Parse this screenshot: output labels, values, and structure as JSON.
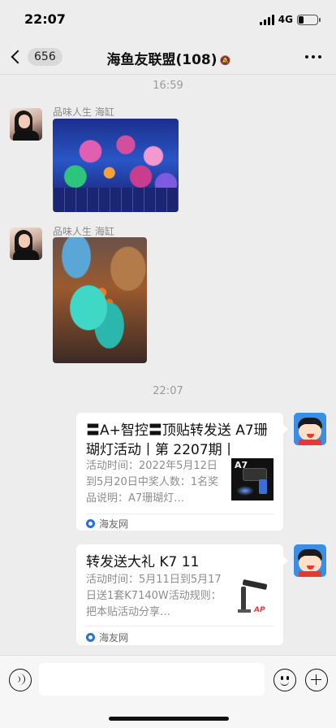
{
  "status_bar": {
    "time": "22:07",
    "network": "4G",
    "battery_level": 0.25
  },
  "header": {
    "back_label": "<",
    "unread_count": "656",
    "title": "海鱼友联盟(108)",
    "mute_icon": "bell-muted-icon",
    "more_icon": "more-dots-icon"
  },
  "messages": {
    "timestamp_1": "16:59",
    "sender_1": "品味人生 海缸",
    "sender_2": "品味人生 海缸",
    "timestamp_2": "22:07",
    "card_1": {
      "title": "〓A+智控〓顶贴转发送 A7珊瑚灯活动丨第 2207期丨",
      "description": "活动时间：2022年5月12日到5月20日中奖人数：1名奖品说明：A7珊瑚灯…",
      "thumb_label": "A7",
      "source": "海友网"
    },
    "card_2": {
      "title": "转发送大礼 K7 11",
      "description": "活动时间：5月11日到5月17日送1套K7140W活动规则：把本贴活动分享…",
      "source": "海友网"
    }
  },
  "input_bar": {
    "voice_icon": "voice-icon",
    "emoji_icon": "emoji-icon",
    "plus_icon": "plus-icon"
  }
}
